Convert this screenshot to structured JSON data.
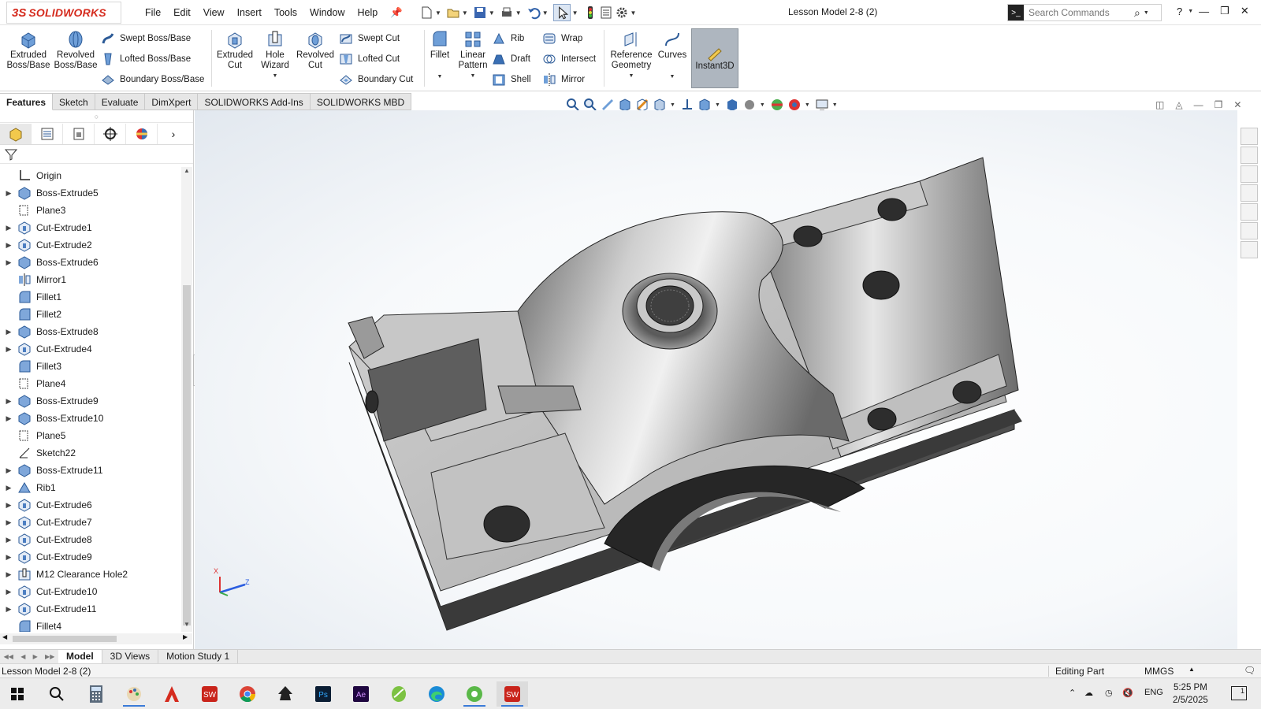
{
  "app": {
    "logo_mark": "3S",
    "logo_text": "SOLIDWORKS",
    "document_title": "Lesson Model 2-8 (2)",
    "menu": [
      "File",
      "Edit",
      "View",
      "Insert",
      "Tools",
      "Window",
      "Help"
    ]
  },
  "search": {
    "placeholder": "Search Commands"
  },
  "ribbon": {
    "extruded_boss": "Extruded Boss/Base",
    "revolved_boss": "Revolved Boss/Base",
    "swept_boss": "Swept Boss/Base",
    "lofted_boss": "Lofted Boss/Base",
    "boundary_boss": "Boundary Boss/Base",
    "extruded_cut": "Extruded Cut",
    "hole_wizard": "Hole Wizard",
    "revolved_cut": "Revolved Cut",
    "swept_cut": "Swept Cut",
    "lofted_cut": "Lofted Cut",
    "boundary_cut": "Boundary Cut",
    "fillet": "Fillet",
    "linear_pattern": "Linear Pattern",
    "rib": "Rib",
    "draft": "Draft",
    "shell": "Shell",
    "wrap": "Wrap",
    "intersect": "Intersect",
    "mirror": "Mirror",
    "reference_geometry": "Reference Geometry",
    "curves": "Curves",
    "instant3d": "Instant3D"
  },
  "command_tabs": [
    "Features",
    "Sketch",
    "Evaluate",
    "DimXpert",
    "SOLIDWORKS Add-Ins",
    "SOLIDWORKS MBD"
  ],
  "tree": [
    {
      "label": "Origin",
      "icon": "origin-icon",
      "expand": false
    },
    {
      "label": "Boss-Extrude5",
      "icon": "boss-extrude-icon",
      "expand": true
    },
    {
      "label": "Plane3",
      "icon": "plane-icon",
      "expand": false
    },
    {
      "label": "Cut-Extrude1",
      "icon": "cut-extrude-icon",
      "expand": true
    },
    {
      "label": "Cut-Extrude2",
      "icon": "cut-extrude-icon",
      "expand": true
    },
    {
      "label": "Boss-Extrude6",
      "icon": "boss-extrude-icon",
      "expand": true
    },
    {
      "label": "Mirror1",
      "icon": "mirror-icon",
      "expand": false
    },
    {
      "label": "Fillet1",
      "icon": "fillet-icon",
      "expand": false
    },
    {
      "label": "Fillet2",
      "icon": "fillet-icon",
      "expand": false
    },
    {
      "label": "Boss-Extrude8",
      "icon": "boss-extrude-icon",
      "expand": true
    },
    {
      "label": "Cut-Extrude4",
      "icon": "cut-extrude-icon",
      "expand": true
    },
    {
      "label": "Fillet3",
      "icon": "fillet-icon",
      "expand": false
    },
    {
      "label": "Plane4",
      "icon": "plane-icon",
      "expand": false
    },
    {
      "label": "Boss-Extrude9",
      "icon": "boss-extrude-icon",
      "expand": true
    },
    {
      "label": "Boss-Extrude10",
      "icon": "boss-extrude-icon",
      "expand": true
    },
    {
      "label": "Plane5",
      "icon": "plane-icon",
      "expand": false
    },
    {
      "label": "Sketch22",
      "icon": "sketch-icon",
      "expand": false
    },
    {
      "label": "Boss-Extrude11",
      "icon": "boss-extrude-icon",
      "expand": true
    },
    {
      "label": "Rib1",
      "icon": "rib-icon",
      "expand": true
    },
    {
      "label": "Cut-Extrude6",
      "icon": "cut-extrude-icon",
      "expand": true
    },
    {
      "label": "Cut-Extrude7",
      "icon": "cut-extrude-icon",
      "expand": true
    },
    {
      "label": "Cut-Extrude8",
      "icon": "cut-extrude-icon",
      "expand": true
    },
    {
      "label": "Cut-Extrude9",
      "icon": "cut-extrude-icon",
      "expand": true
    },
    {
      "label": "M12 Clearance Hole2",
      "icon": "hole-icon",
      "expand": true
    },
    {
      "label": "Cut-Extrude10",
      "icon": "cut-extrude-icon",
      "expand": true
    },
    {
      "label": "Cut-Extrude11",
      "icon": "cut-extrude-icon",
      "expand": true
    },
    {
      "label": "Fillet4",
      "icon": "fillet-icon",
      "expand": false
    }
  ],
  "triad": {
    "x": "X",
    "z": "Z"
  },
  "bottom_tabs": [
    "Model",
    "3D Views",
    "Motion Study 1"
  ],
  "status": {
    "left": "Lesson Model 2-8 (2)",
    "mode": "Editing Part",
    "units": "MMGS"
  },
  "taskbar": {
    "lang": "ENG",
    "time": "5:25 PM",
    "date": "2/5/2025",
    "notifications": "1"
  },
  "colors": {
    "brand": "#d52b1e",
    "accent": "#3b7bd8",
    "instant3d_active": "#aeb6bf"
  }
}
